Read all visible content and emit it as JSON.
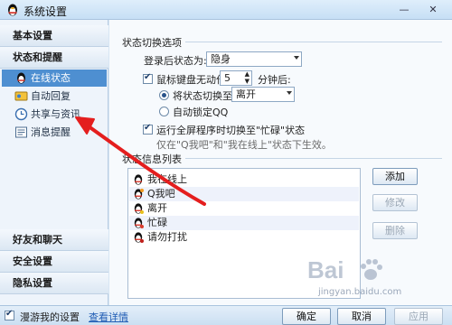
{
  "window": {
    "title": "系统设置",
    "minimize": "—",
    "close": "✕"
  },
  "sidebar": {
    "categories": [
      {
        "label": "基本设置"
      },
      {
        "label": "状态和提醒"
      },
      {
        "label": "好友和聊天"
      },
      {
        "label": "安全设置"
      },
      {
        "label": "隐私设置"
      }
    ],
    "items": [
      {
        "label": "在线状态",
        "icon": "online-status-icon",
        "active": true
      },
      {
        "label": "自动回复",
        "icon": "auto-reply-icon",
        "active": false
      },
      {
        "label": "共享与资讯",
        "icon": "clock-icon",
        "active": false
      },
      {
        "label": "消息提醒",
        "icon": "message-icon",
        "active": false
      }
    ]
  },
  "status_switch": {
    "section_title": "状态切换选项",
    "login_status_label": "登录后状态为:",
    "login_status_value": "隐身",
    "idle_label": "鼠标键盘无动作",
    "idle_minutes": "5",
    "idle_suffix": "分钟后:",
    "switch_to_label": "将状态切换至",
    "switch_to_value": "离开",
    "lock_label": "自动锁定QQ",
    "fullscreen_label": "运行全屏程序时切换至\"忙碌\"状态",
    "fullscreen_hint": "仅在\"Q我吧\"和\"我在线上\"状态下生效。"
  },
  "status_info": {
    "section_title": "状态信息列表",
    "rows": [
      "我在线上",
      "Q我吧",
      "离开",
      "忙碌",
      "请勿打扰"
    ],
    "add_button": "添加",
    "edit_button": "修改",
    "delete_button": "删除"
  },
  "bottom": {
    "roam_label": "漫游我的设置",
    "details_link": "查看详情",
    "ok_button": "确定",
    "cancel_button": "取消",
    "apply_button": "应用"
  },
  "watermark": {
    "brand": "Bai",
    "site": "jingyan.baidu.com"
  },
  "colors": {
    "accent": "#4e8fd1",
    "arrow": "#e41e1e"
  }
}
